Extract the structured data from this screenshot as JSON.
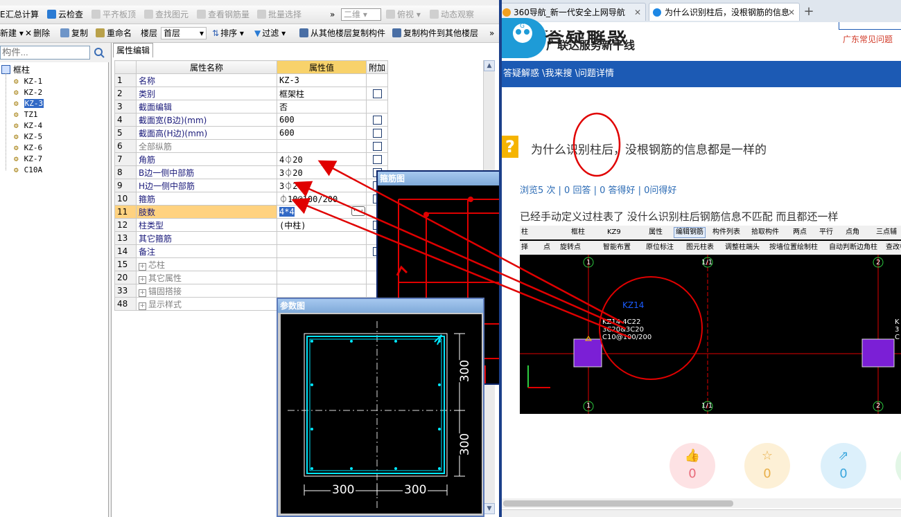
{
  "toolbar1": {
    "items": [
      "汇总计算",
      "云检查",
      "平齐板顶",
      "查找图元",
      "查看钢筋量",
      "批量选择",
      "二维",
      "俯视",
      "动态观察"
    ]
  },
  "toolbar2": {
    "items": [
      "新建",
      "删除",
      "复制",
      "重命名",
      "楼层",
      "首层",
      "排序",
      "过滤",
      "从其他楼层复制构件",
      "复制构件到其他楼层"
    ]
  },
  "search": {
    "placeholder": "构件..."
  },
  "tree": {
    "root": "框柱",
    "items": [
      "KZ-1",
      "KZ-2",
      "KZ-3",
      "TZ1",
      "KZ-4",
      "KZ-5",
      "KZ-6",
      "KZ-7",
      "C10A"
    ],
    "selected": "KZ-3"
  },
  "props": {
    "tab_label": "属性编辑",
    "headers": {
      "name": "属性名称",
      "value": "属性值",
      "extra": "附加"
    },
    "rows": [
      {
        "num": "1",
        "name": "名称",
        "value": "KZ-3",
        "check": false
      },
      {
        "num": "2",
        "name": "类别",
        "value": "框架柱",
        "check": true
      },
      {
        "num": "3",
        "name": "截面编辑",
        "value": "否",
        "check": false
      },
      {
        "num": "4",
        "name": "截面宽(B边)(mm)",
        "value": "600",
        "check": true
      },
      {
        "num": "5",
        "name": "截面高(H边)(mm)",
        "value": "600",
        "check": true
      },
      {
        "num": "6",
        "name": "全部纵筋",
        "value": "",
        "check": true
      },
      {
        "num": "7",
        "name": "角筋",
        "value": "4⏀20",
        "check": true
      },
      {
        "num": "8",
        "name": "B边一侧中部筋",
        "value": "3⏀20",
        "check": true
      },
      {
        "num": "9",
        "name": "H边一侧中部筋",
        "value": "3⏀20",
        "check": true
      },
      {
        "num": "10",
        "name": "箍筋",
        "value": "⏀10@100/200",
        "check": true
      },
      {
        "num": "11",
        "name": "肢数",
        "value": "4*4",
        "check": false
      },
      {
        "num": "12",
        "name": "柱类型",
        "value": "(中柱)",
        "check": true
      },
      {
        "num": "13",
        "name": "其它箍筋",
        "value": "",
        "check": false
      },
      {
        "num": "14",
        "name": "备注",
        "value": "",
        "check": true
      },
      {
        "num": "15",
        "name": "芯柱",
        "value": "",
        "check": false
      },
      {
        "num": "20",
        "name": "其它属性",
        "value": "",
        "check": false
      },
      {
        "num": "33",
        "name": "锚固搭接",
        "value": "",
        "check": false
      },
      {
        "num": "48",
        "name": "显示样式",
        "value": "",
        "check": false
      }
    ]
  },
  "stirrup_window": {
    "title": "箍筋图"
  },
  "param_window": {
    "title": "参数图",
    "dims": {
      "top_a": "300",
      "top_b": "300",
      "bottom_a": "300",
      "bottom_b": "300"
    }
  },
  "browser": {
    "tabs": [
      {
        "label": "360导航_新一代安全上网导航"
      },
      {
        "label": "为什么识别柱后，没根钢筋的信息"
      }
    ],
    "logo_big": "答疑解惑",
    "logo_sub": "广联达服务新干线",
    "region": "广东常见问题",
    "breadcrumb": "答疑解惑 \\我来搜 \\问题详情",
    "question_icon": "?",
    "question_title": "为什么识别柱后，没根钢筋的信息都是一样的",
    "stats": "浏览5 次 | 0 回答 | 0 答得好 | 0问得好",
    "body": "已经手动定义过柱表了 没什么识别柱后钢筋信息不匹配 而且都还一样",
    "embed": {
      "tb1": [
        "柱",
        "框柱",
        "KZ9",
        "属性",
        "编辑钢筋",
        "构件列表",
        "拾取构件",
        "两点",
        "平行",
        "点角",
        "三点辅"
      ],
      "tb2": [
        "择",
        "点",
        "旋转点",
        "智能布置",
        "原位标注",
        "图元柱表",
        "调整柱端头",
        "按墙位置绘制柱",
        "自动判断边角柱",
        "查改标"
      ],
      "axis_labels": [
        "1",
        "1/1",
        "2",
        "1",
        "1/1",
        "2"
      ],
      "col_name": "KZ14",
      "col_text": [
        "KZ14 4C22",
        "3C20&3C20",
        "C10@100/200"
      ],
      "right_label": [
        "K",
        "3",
        "C"
      ]
    },
    "reactions": [
      "0",
      "0",
      "0"
    ]
  },
  "colors": {
    "accent": "#1c5ab4",
    "annotation_red": "#e00000",
    "cyan": "#00e8ff"
  }
}
